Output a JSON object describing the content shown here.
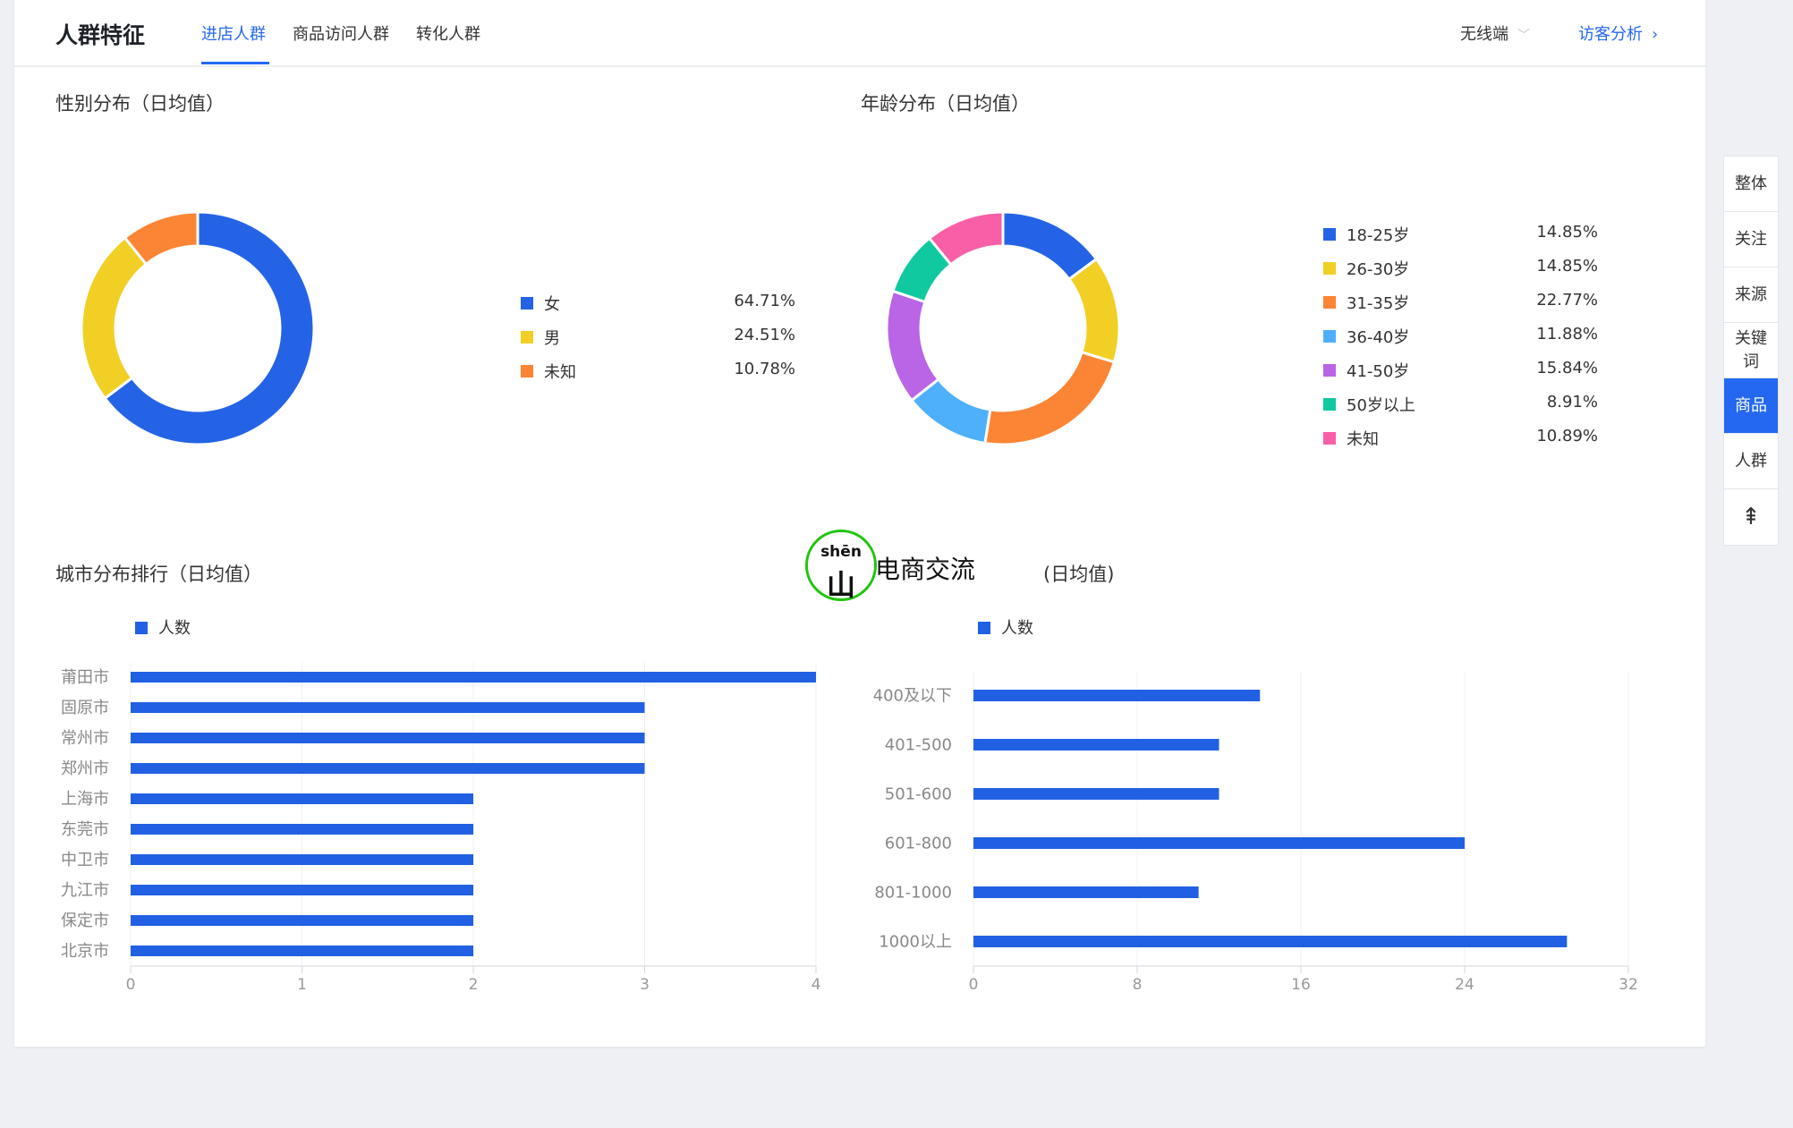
{
  "header": {
    "title": "人群特征",
    "tabs": [
      {
        "label": "进店人群",
        "active": true
      },
      {
        "label": "商品访问人群",
        "active": false
      },
      {
        "label": "转化人群",
        "active": false
      }
    ],
    "device_select": "无线端",
    "visitor_link": "访客分析"
  },
  "icons": {
    "chevron_down": "﹀",
    "chevron_right": "›",
    "back_to_top": "⇞"
  },
  "watermark": {
    "pinyin": "shēn",
    "glyph": "山",
    "text": "电商交流",
    "color": "#22c40f"
  },
  "sidebar": {
    "items": [
      {
        "label": "整体",
        "active": false
      },
      {
        "label": "关注",
        "active": false
      },
      {
        "label": "来源",
        "active": false
      },
      {
        "label": "关键词",
        "active": false
      },
      {
        "label": "商品",
        "active": true
      },
      {
        "label": "人群",
        "active": false
      }
    ]
  },
  "colors": {
    "accent": "#2468f2",
    "bar": "#2160e2"
  },
  "chart_data": [
    {
      "type": "pie",
      "donut": true,
      "title": "性别分布（日均值）",
      "categories": [
        "女",
        "男",
        "未知"
      ],
      "values": [
        64.71,
        24.51,
        10.78
      ],
      "labels": [
        "64.71%",
        "24.51%",
        "10.78%"
      ],
      "colors": [
        "#2463e6",
        "#f2cf24",
        "#fb8534"
      ],
      "legend": "right"
    },
    {
      "type": "pie",
      "donut": true,
      "title": "年龄分布（日均值）",
      "categories": [
        "18-25岁",
        "26-30岁",
        "31-35岁",
        "36-40岁",
        "41-50岁",
        "50岁以上",
        "未知"
      ],
      "values": [
        14.85,
        14.85,
        22.77,
        11.88,
        15.84,
        8.91,
        10.89
      ],
      "labels": [
        "14.85%",
        "14.85%",
        "22.77%",
        "11.88%",
        "15.84%",
        "8.91%",
        "10.89%"
      ],
      "colors": [
        "#2463e6",
        "#f2cf24",
        "#fb8534",
        "#4eb0fb",
        "#b965e6",
        "#10c9a0",
        "#f95fa7"
      ],
      "legend": "right"
    },
    {
      "type": "bar",
      "orientation": "horizontal",
      "title": "城市分布排行（日均值）",
      "legend": [
        "人数"
      ],
      "categories": [
        "莆田市",
        "固原市",
        "常州市",
        "郑州市",
        "上海市",
        "东莞市",
        "中卫市",
        "九江市",
        "保定市",
        "北京市"
      ],
      "values": [
        4,
        3,
        3,
        3,
        2,
        2,
        2,
        2,
        2,
        2
      ],
      "xlim": [
        0,
        4
      ],
      "xticks": [
        "0",
        "1",
        "2",
        "3",
        "4"
      ],
      "grid": true
    },
    {
      "type": "bar",
      "orientation": "horizontal",
      "title": "(日均值)",
      "legend": [
        "人数"
      ],
      "categories": [
        "400及以下",
        "401-500",
        "501-600",
        "601-800",
        "801-1000",
        "1000以上"
      ],
      "values": [
        14,
        12,
        12,
        24,
        11,
        29
      ],
      "xlim": [
        0,
        32
      ],
      "xticks": [
        "0",
        "8",
        "16",
        "24",
        "32"
      ],
      "grid": true
    }
  ]
}
